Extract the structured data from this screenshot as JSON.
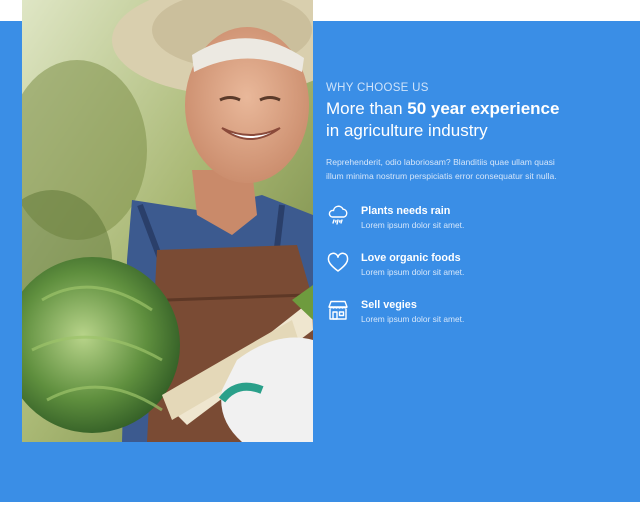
{
  "section": {
    "eyebrow": "WHY CHOOSE US",
    "headline_prefix": "More than ",
    "headline_bold": "50 year experience",
    "headline_suffix": "in agriculture industry",
    "description": "Reprehenderit, odio laboriosam? Blanditiis quae ullam quasi illum minima nostrum perspiciatis error consequatur sit nulla."
  },
  "features": [
    {
      "icon": "rain-cloud-icon",
      "title": "Plants needs rain",
      "text": "Lorem ipsum dolor sit amet."
    },
    {
      "icon": "heart-icon",
      "title": "Love organic foods",
      "text": "Lorem ipsum dolor sit amet."
    },
    {
      "icon": "shop-icon",
      "title": "Sell vegies",
      "text": "Lorem ipsum dolor sit amet."
    }
  ],
  "colors": {
    "background": "#ffffff",
    "accent_blue": "#3a8ee6",
    "text_white": "#ffffff",
    "text_muted": "#d5e6fa"
  }
}
